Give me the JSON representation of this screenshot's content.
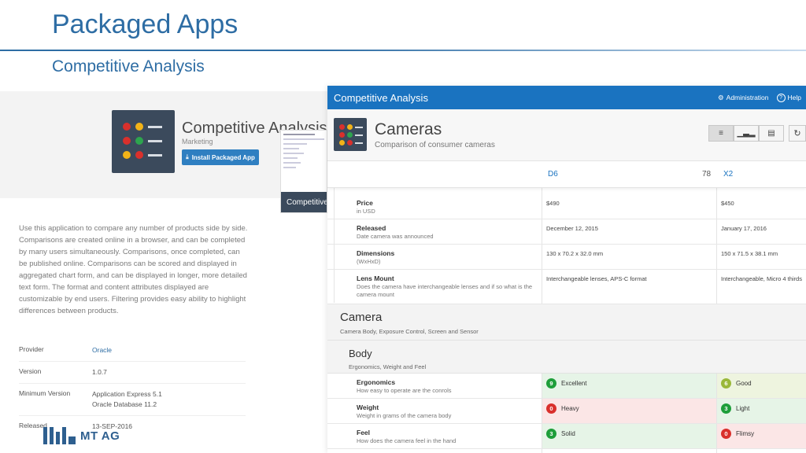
{
  "slide": {
    "title": "Packaged Apps",
    "subtitle": "Competitive Analysis"
  },
  "gallery": {
    "app_name": "Competitive Analysis",
    "category": "Marketing",
    "install_label": "Install Packaged App",
    "description": "Use this application to compare any number of products side by side. Comparisons are created online in a browser, and can be completed by many users simultaneously. Comparisons, once completed, can be published online. Comparisons can be scored and displayed in aggregated chart form, and can be displayed in longer, more detailed text form. The format and content attributes displayed are customizable by end users. Filtering provides easy ability to highlight differences between products.",
    "thumbnail_caption": "Competitive",
    "meta": [
      {
        "key": "Provider",
        "value": "Oracle",
        "value2": ""
      },
      {
        "key": "Version",
        "value": "1.0.7",
        "value2": ""
      },
      {
        "key": "Minimum Version",
        "value": "Application Express 5.1",
        "value2": "Oracle Database 11.2"
      },
      {
        "key": "Released",
        "value": "13-SEP-2016",
        "value2": ""
      }
    ],
    "logo_text": "MT AG"
  },
  "app": {
    "nav_title": "Competitive Analysis",
    "nav_admin": "Administration",
    "nav_help": "Help",
    "page_title": "Cameras",
    "page_subtitle": "Comparison of consumer cameras",
    "columns": [
      {
        "name": "D6",
        "score": "78"
      },
      {
        "name": "X2",
        "score": ""
      }
    ],
    "info_rows": [
      {
        "label": "Price",
        "desc": "in USD",
        "v1": "$490",
        "v2": "$450"
      },
      {
        "label": "Released",
        "desc": "Date camera was announced",
        "v1": "December 12, 2015",
        "v2": "January 17, 2016"
      },
      {
        "label": "Dimensions",
        "desc": "(WxHxD)",
        "v1": "130 x 70.2 x 32.0 mm",
        "v2": "150 x 71.5 x 38.1 mm"
      },
      {
        "label": "Lens Mount",
        "desc": "Does the camera have interchangeable lenses and if so what is the camera mount",
        "v1": "Interchangeable lenses, APS-C format",
        "v2": "Interchangeable, Micro 4 thirds"
      }
    ],
    "section": {
      "title": "Camera",
      "desc": "Camera Body, Exposure Control, Screen and Sensor"
    },
    "subsection": {
      "title": "Body",
      "desc": "Ergonomics, Weight and Feel"
    },
    "score_rows": [
      {
        "label": "Ergonomics",
        "desc": "How easy to operate are the conrols",
        "s1": "9",
        "t1": "Excellent",
        "c1": "#1e9e3a",
        "bg1": "#e6f4e7",
        "s2": "6",
        "t2": "Good",
        "c2": "#9ab83a",
        "bg2": "#eef4df"
      },
      {
        "label": "Weight",
        "desc": "Weight in grams of the camera body",
        "s1": "0",
        "t1": "Heavy",
        "c1": "#d9302c",
        "bg1": "#fbe6e6",
        "s2": "3",
        "t2": "Light",
        "c2": "#1e9e3a",
        "bg2": "#e6f4e7"
      },
      {
        "label": "Feel",
        "desc": "How does the camera feel in the hand",
        "s1": "3",
        "t1": "Solid",
        "c1": "#1e9e3a",
        "bg1": "#e6f4e7",
        "s2": "0",
        "t2": "Flimsy",
        "c2": "#d9302c",
        "bg2": "#fbe6e6"
      }
    ]
  },
  "colors": {
    "brand_blue": "#2e6da4",
    "apex_blue": "#1a73c0",
    "icon_dark": "#3b4a5c"
  }
}
